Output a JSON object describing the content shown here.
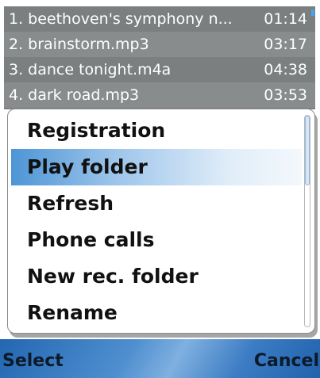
{
  "playlist": {
    "tracks": [
      {
        "title": "1. beethoven's symphony n...",
        "duration": "01:14"
      },
      {
        "title": "2. brainstorm.mp3",
        "duration": "03:17"
      },
      {
        "title": "3. dance tonight.m4a",
        "duration": "04:38"
      },
      {
        "title": "4. dark road.mp3",
        "duration": "03:53"
      }
    ]
  },
  "menu": {
    "items": [
      {
        "label": "Registration"
      },
      {
        "label": "Play folder"
      },
      {
        "label": "Refresh"
      },
      {
        "label": "Phone calls"
      },
      {
        "label": "New rec. folder"
      },
      {
        "label": "Rename"
      }
    ],
    "selected_index": 1
  },
  "softkeys": {
    "left_label": "Select",
    "right_label": "Cancel"
  },
  "colors": {
    "accent": "#2a6cb4",
    "highlight": "#4d95d6",
    "list_background": "#7b7f80"
  }
}
